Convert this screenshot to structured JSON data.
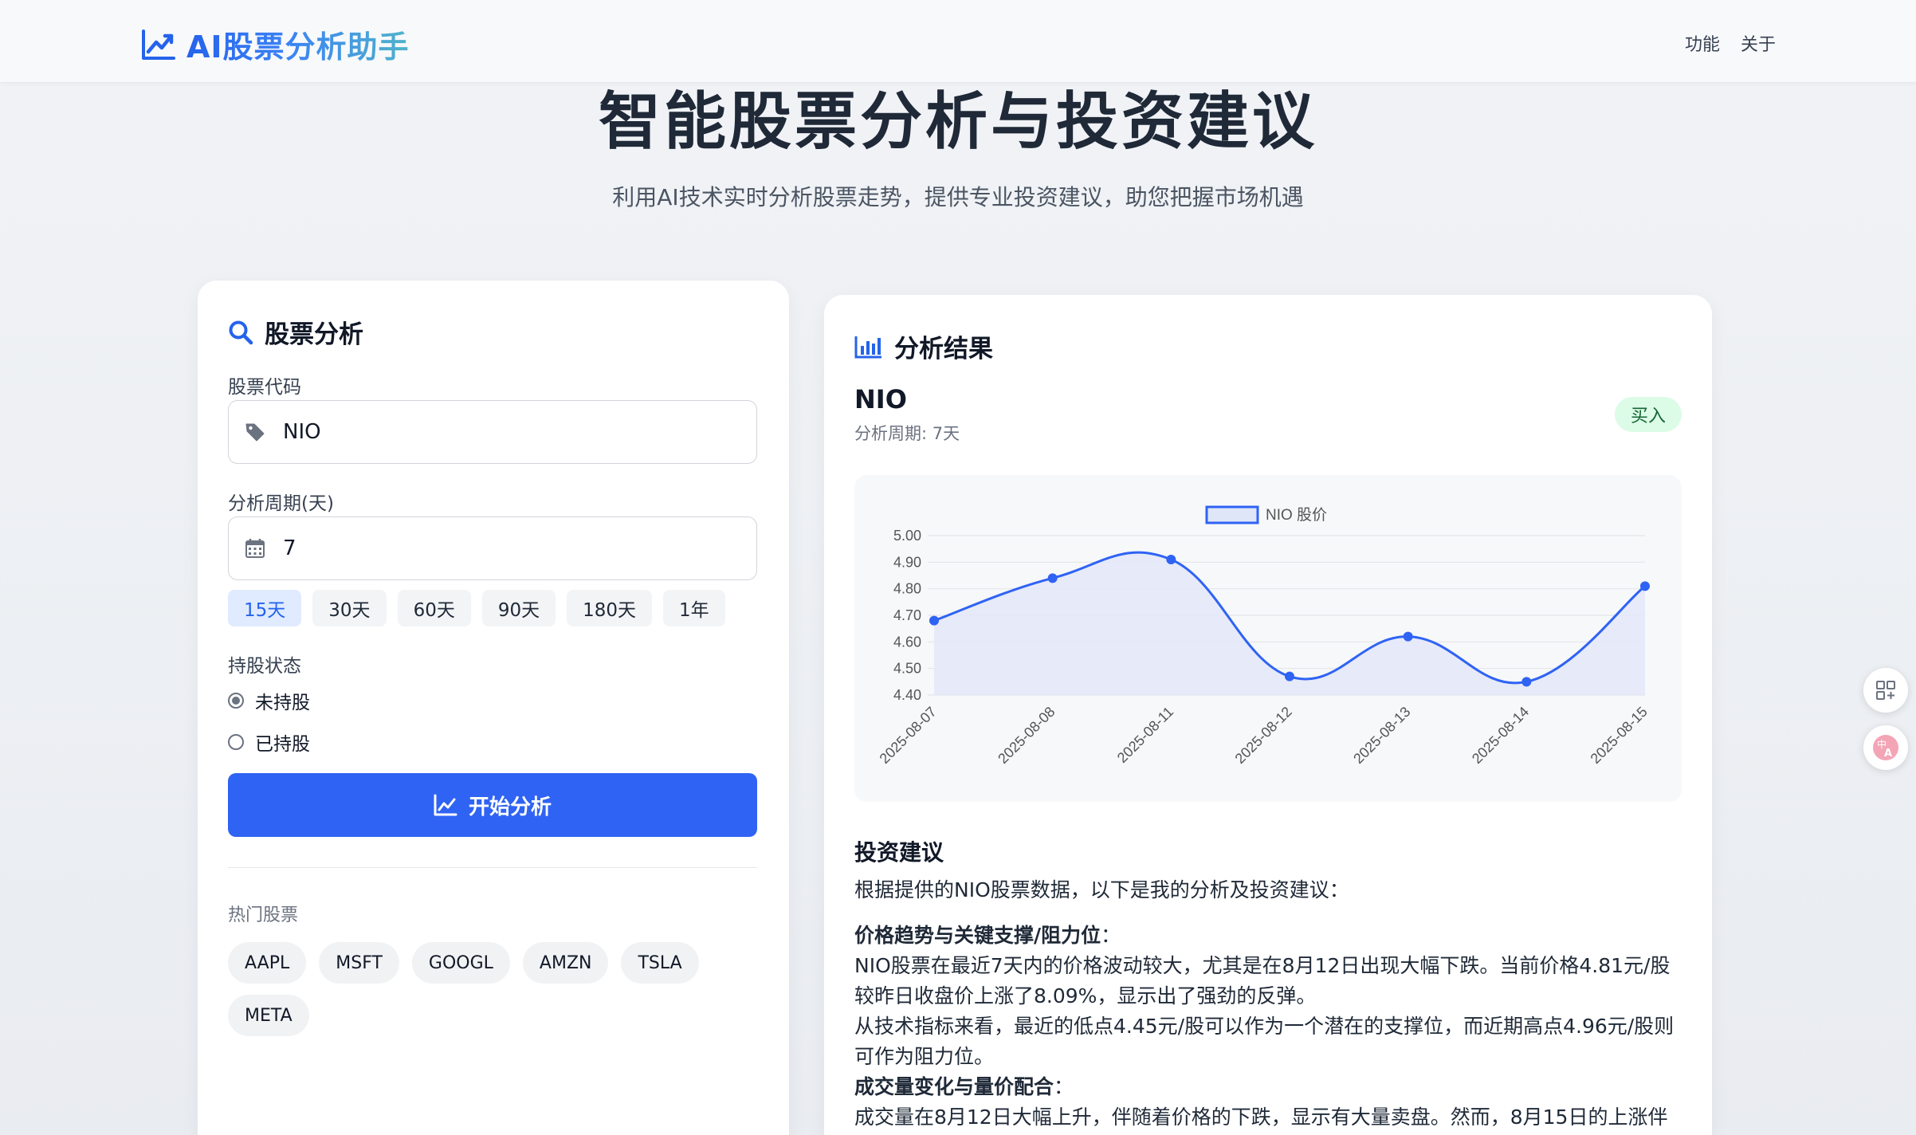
{
  "nav": {
    "brand": "AI股票分析助手",
    "links": [
      "功能",
      "关于"
    ]
  },
  "hero": {
    "title": "智能股票分析与投资建议",
    "subtitle": "利用AI技术实时分析股票走势，提供专业投资建议，助您把握市场机遇"
  },
  "form": {
    "title": "股票分析",
    "code_label": "股票代码",
    "code_value": "NIO",
    "period_label": "分析周期(天)",
    "period_value": "7",
    "period_options": [
      "15天",
      "30天",
      "60天",
      "90天",
      "180天",
      "1年"
    ],
    "active_period": "15天",
    "holding_label": "持股状态",
    "holding_options": [
      "未持股",
      "已持股"
    ],
    "holding_selected": "未持股",
    "submit_label": "开始分析",
    "hot_label": "热门股票",
    "hot_stocks": [
      "AAPL",
      "MSFT",
      "GOOGL",
      "AMZN",
      "TSLA",
      "META"
    ]
  },
  "result": {
    "title": "分析结果",
    "ticker": "NIO",
    "period_text": "分析周期: 7天",
    "recommendation": "买入",
    "advice_title": "投资建议",
    "intro": "根据提供的NIO股票数据，以下是我的分析及投资建议：",
    "section1_heading": "价格趋势与关键支撑/阻力位",
    "section1_colon": "：",
    "section1_line1": "NIO股票在最近7天内的价格波动较大，尤其是在8月12日出现大幅下跌。当前价格4.81元/股较昨日收盘价上涨了8.09%，显示出了强劲的反弹。",
    "section1_line2": "从技术指标来看，最近的低点4.45元/股可以作为一个潜在的支撑位，而近期高点4.96元/股则可作为阻力位。",
    "section2_heading": "成交量变化与量价配合",
    "section2_colon": "：",
    "section2_line1": "成交量在8月12日大幅上升，伴随着价格的下跌，显示有大量卖盘。然而，8月15日的上涨伴"
  },
  "chart_data": {
    "type": "line",
    "x": [
      "2025-08-07",
      "2025-08-08",
      "2025-08-11",
      "2025-08-12",
      "2025-08-13",
      "2025-08-14",
      "2025-08-15"
    ],
    "series": [
      {
        "name": "NIO 股价",
        "values": [
          4.68,
          4.84,
          4.91,
          4.47,
          4.62,
          4.45,
          4.81
        ]
      }
    ],
    "ylim": [
      4.4,
      5.0
    ],
    "yticks": [
      "5.00",
      "4.90",
      "4.80",
      "4.70",
      "4.60",
      "4.50",
      "4.40"
    ],
    "legend": "top-center",
    "grid": true,
    "area_fill": true,
    "colors": {
      "line": "#2f63f4",
      "fill": "#e3e8f8"
    }
  },
  "colors": {
    "primary": "#2f63f4",
    "badge_bg": "#dcfce7",
    "badge_text": "#166534"
  }
}
